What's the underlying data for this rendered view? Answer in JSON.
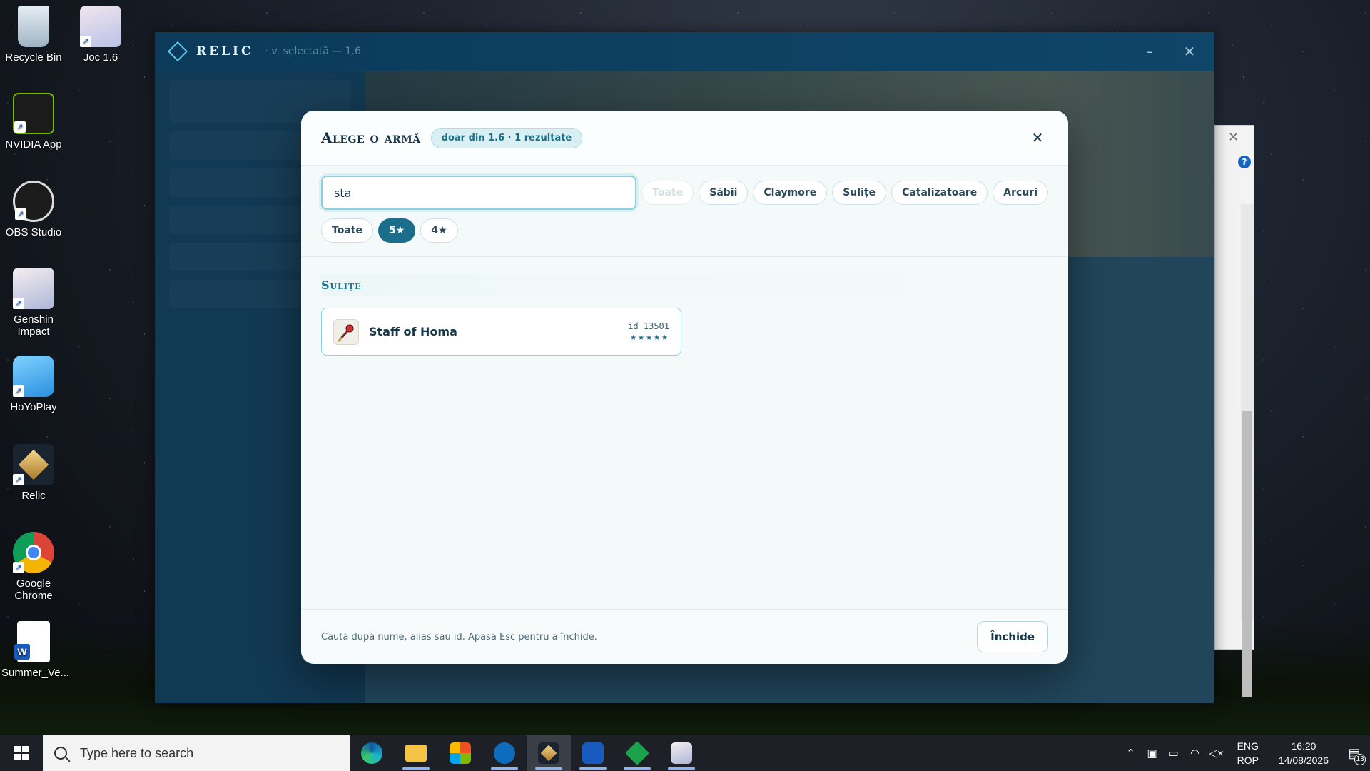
{
  "desktop": {
    "icons": [
      {
        "label": "Recycle Bin",
        "icon": "recycle-bin-icon"
      },
      {
        "label": "Joc 1.6",
        "icon": "game-shortcut-icon"
      },
      {
        "label": "NVIDIA App",
        "icon": "nvidia-icon"
      },
      {
        "label": "OBS Studio",
        "icon": "obs-icon"
      },
      {
        "label": "Genshin Impact",
        "icon": "genshin-icon"
      },
      {
        "label": "HoYoPlay",
        "icon": "hoyoplay-icon"
      },
      {
        "label": "Relic",
        "icon": "relic-icon"
      },
      {
        "label": "Google Chrome",
        "icon": "chrome-icon"
      },
      {
        "label": "Summer_Ve...",
        "icon": "word-document-icon"
      }
    ]
  },
  "relic_window": {
    "name": "RELIC",
    "subtitle": "· v. selectată — 1.6",
    "minimize": "–",
    "close": "✕"
  },
  "modal": {
    "title": "Alege o armă",
    "badge": "doar din 1.6 · 1 rezultate",
    "close": "✕",
    "search": {
      "value": "sta",
      "placeholder": ""
    },
    "type_filters": [
      "Toate",
      "Săbii",
      "Claymore",
      "Sulițe",
      "Catalizatoare",
      "Arcuri"
    ],
    "rarity_filters": [
      "Toate",
      "5★",
      "4★"
    ],
    "active_rarity": "5★",
    "group": {
      "title": "Sulițe",
      "items": [
        {
          "name": "Staff of Homa",
          "id": "id 13501",
          "stars": "★★★★★"
        }
      ]
    },
    "footer_hint": "Caută după nume, alias sau id. Apasă Esc pentru a închide.",
    "close_button": "Închide"
  },
  "taskbar": {
    "search_placeholder": "Type here to search",
    "apps": [
      "edge-icon",
      "file-explorer-icon",
      "store-icon",
      "outlook-icon",
      "relic-icon",
      "word-icon",
      "green-app-icon",
      "genshin-icon"
    ],
    "lang_top": "ENG",
    "lang_bottom": "ROP",
    "time": "16:20",
    "date": "14/08/2026",
    "notifications": "13"
  },
  "colors": {
    "accent": "#1a6e8c",
    "modal_bg": "#f4fafa",
    "window_bg": "#0f3b58"
  }
}
